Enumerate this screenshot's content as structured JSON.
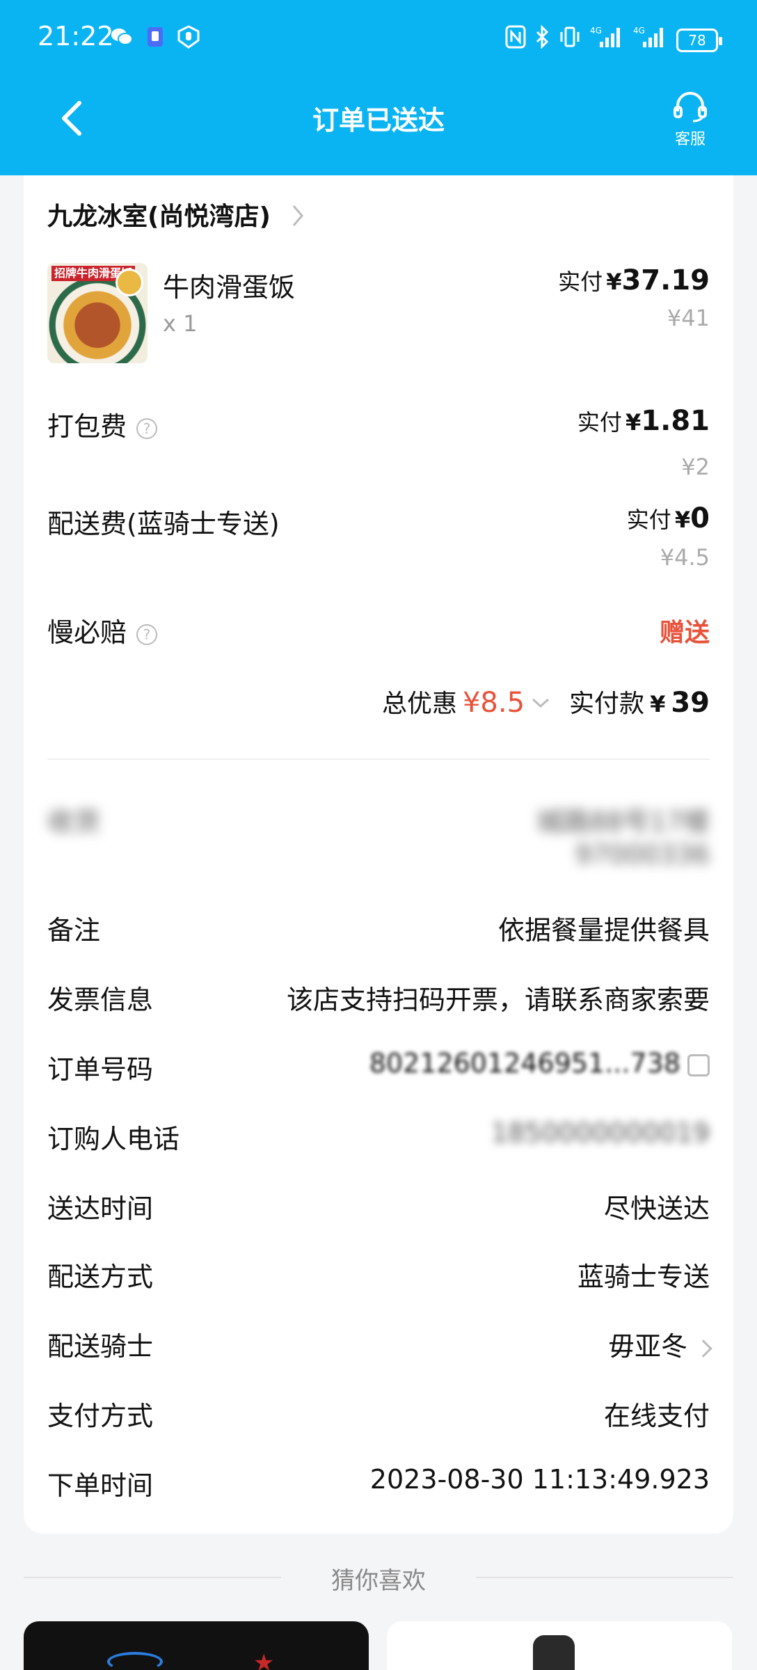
{
  "status_bar": {
    "time": "21:22",
    "signal_label_1": "4G",
    "signal_label_2": "4G",
    "battery": "78"
  },
  "header": {
    "title": "订单已送达",
    "customer_service_label": "客服",
    "background_color": "#0ab4f2"
  },
  "store": {
    "name": "九龙冰室(尚悦湾店)"
  },
  "item": {
    "name": "牛肉滑蛋饭",
    "quantity": "x 1",
    "pay_label": "实付",
    "pay_currency": "¥",
    "pay_amount": "37.19",
    "original_price": "¥41",
    "image_tag": "招牌牛肉滑蛋饭"
  },
  "packing_fee": {
    "label": "打包费",
    "pay_label": "实付",
    "pay_currency": "¥",
    "pay_amount": "1.81",
    "original_price": "¥2"
  },
  "delivery_fee": {
    "label": "配送费(蓝骑士专送)",
    "pay_label": "实付",
    "pay_currency": "¥",
    "pay_amount": "0",
    "original_price": "¥4.5"
  },
  "late_compensation": {
    "label": "慢必赔",
    "value": "赠送"
  },
  "summary": {
    "discount_label": "总优惠",
    "discount_amount": "¥8.5",
    "total_label": "实付款",
    "total_currency": "¥",
    "total_amount": "39"
  },
  "info": {
    "address_label": "收货",
    "address_line1": "城路88号17楼",
    "address_line2": "97000336",
    "remark_label": "备注",
    "remark_value": "依据餐量提供餐具",
    "invoice_label": "发票信息",
    "invoice_value": "该店支持扫码开票，请联系商家索要",
    "order_no_label": "订单号码",
    "order_no_value": "80212601246951...738",
    "phone_label": "订购人电话",
    "phone_value": "1850000000019",
    "delivery_time_label": "送达时间",
    "delivery_time_value": "尽快送达",
    "delivery_method_label": "配送方式",
    "delivery_method_value": "蓝骑士专送",
    "rider_label": "配送骑士",
    "rider_value": "毋亚冬",
    "payment_label": "支付方式",
    "payment_value": "在线支付",
    "order_time_label": "下单时间",
    "order_time_value": "2023-08-30 11:13:49.923"
  },
  "recommend": {
    "title": "猜你喜欢"
  }
}
